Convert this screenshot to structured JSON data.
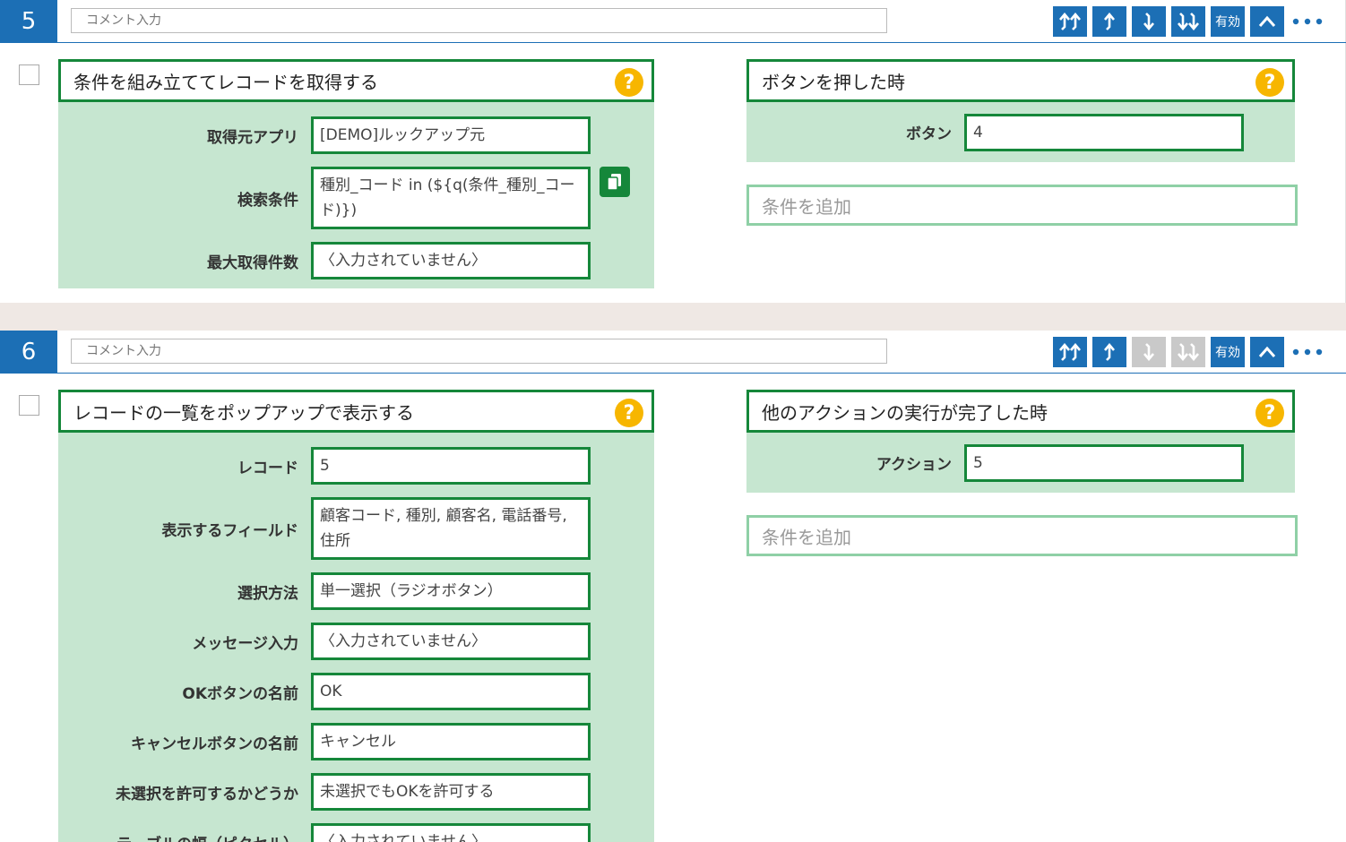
{
  "blocks": [
    {
      "number": "5",
      "comment_placeholder": "コメント入力",
      "toolbar": {
        "enabled_label": "有効"
      },
      "action": {
        "title": "条件を組み立ててレコードを取得する",
        "fields": [
          {
            "label": "取得元アプリ",
            "value": "[DEMO]ルックアップ元"
          },
          {
            "label": "検索条件",
            "value": "種別_コード in (${q(条件_種別_コード)})"
          },
          {
            "label": "最大取得件数",
            "value": "〈入力されていません〉"
          }
        ]
      },
      "condition": {
        "title": "ボタンを押した時",
        "field_label": "ボタン",
        "field_value": "4",
        "add_label": "条件を追加"
      }
    },
    {
      "number": "6",
      "comment_placeholder": "コメント入力",
      "toolbar": {
        "enabled_label": "有効"
      },
      "action": {
        "title": "レコードの一覧をポップアップで表示する",
        "fields": [
          {
            "label": "レコード",
            "value": "5"
          },
          {
            "label": "表示するフィールド",
            "value": "顧客コード, 種別, 顧客名, 電話番号, 住所"
          },
          {
            "label": "選択方法",
            "value": "単一選択（ラジオボタン）"
          },
          {
            "label": "メッセージ入力",
            "value": "〈入力されていません〉"
          },
          {
            "label": "OKボタンの名前",
            "value": "OK"
          },
          {
            "label": "キャンセルボタンの名前",
            "value": "キャンセル"
          },
          {
            "label": "未選択を許可するかどうか",
            "value": "未選択でもOKを許可する"
          },
          {
            "label": "テーブルの幅（ピクセル）",
            "value": "〈入力されていません〉"
          }
        ]
      },
      "condition": {
        "title": "他のアクションの実行が完了した時",
        "field_label": "アクション",
        "field_value": "5",
        "add_label": "条件を追加"
      }
    }
  ],
  "colors": {
    "primary_blue": "#1c6fb5",
    "green_border": "#15873a",
    "green_bg": "#c6e6d0",
    "help_yellow": "#f7b600",
    "disabled_gray": "#c9c9c9",
    "separator": "#efe8e4"
  },
  "icons": {
    "move_top": "double-arrow-up-icon",
    "move_up": "arrow-up-icon",
    "move_down": "arrow-down-icon",
    "move_bottom": "double-arrow-down-icon",
    "collapse": "chevron-up-icon",
    "more": "more-dots-icon",
    "help": "question-icon",
    "copy": "copy-icon"
  }
}
